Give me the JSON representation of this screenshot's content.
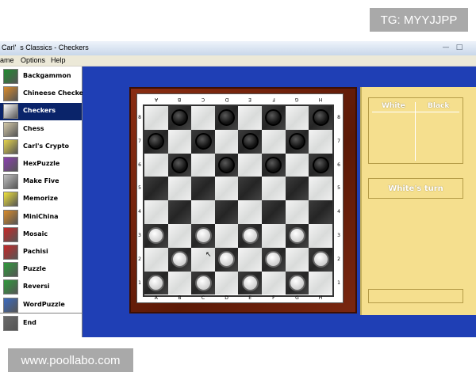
{
  "watermarks": {
    "top_right": "TG: MYYJJPP",
    "bottom_left": "www.poollabo.com"
  },
  "window": {
    "title": "Carl'  s Classics - Checkers"
  },
  "menu": [
    "ame",
    "Options",
    "Help"
  ],
  "sidebar": {
    "items": [
      {
        "label": "Backgammon",
        "icon": "backgammon-icon",
        "color": "#1e8b2e"
      },
      {
        "label": "Chineese Checkers",
        "icon": "chinese-checkers-icon",
        "color": "#d98a2a"
      },
      {
        "label": "Checkers",
        "icon": "checkers-icon",
        "color": "#ffffff",
        "selected": true
      },
      {
        "label": "Chess",
        "icon": "chess-icon",
        "color": "#d4c9a8"
      },
      {
        "label": "Carl's Crypto",
        "icon": "crypto-icon",
        "color": "#e4d34a"
      },
      {
        "label": "HexPuzzle",
        "icon": "hexpuzzle-icon",
        "color": "#8a3fb0"
      },
      {
        "label": "Make Five",
        "icon": "make-five-icon",
        "color": "#bfbfbf"
      },
      {
        "label": "Memorize",
        "icon": "memorize-icon",
        "color": "#f0e33a"
      },
      {
        "label": "MiniChina",
        "icon": "minichina-icon",
        "color": "#d98a2a"
      },
      {
        "label": "Mosaic",
        "icon": "mosaic-icon",
        "color": "#c62828"
      },
      {
        "label": "Pachisi",
        "icon": "pachisi-icon",
        "color": "#c62828"
      },
      {
        "label": "Puzzle",
        "icon": "puzzle-icon",
        "color": "#2e9a3a"
      },
      {
        "label": "Reversi",
        "icon": "reversi-icon",
        "color": "#2e9a3a"
      },
      {
        "label": "WordPuzzle",
        "icon": "wordpuzzle-icon",
        "color": "#3a6ac0"
      },
      {
        "label": "End",
        "icon": "exit-door-icon",
        "color": "#6a6a6a"
      }
    ]
  },
  "board": {
    "files_top": [
      "A",
      "B",
      "C",
      "D",
      "E",
      "F",
      "G",
      "H"
    ],
    "files_bottom": [
      "A",
      "B",
      "C",
      "D",
      "E",
      "F",
      "G",
      "H"
    ],
    "ranks": [
      "8",
      "7",
      "6",
      "5",
      "4",
      "3",
      "2",
      "1"
    ],
    "pieces": {
      "8": [
        "",
        "b",
        "",
        "b",
        "",
        "b",
        "",
        "b"
      ],
      "7": [
        "b",
        "",
        "b",
        "",
        "b",
        "",
        "b",
        ""
      ],
      "6": [
        "",
        "b",
        "",
        "b",
        "",
        "b",
        "",
        "b"
      ],
      "5": [
        "",
        "",
        "",
        "",
        "",
        "",
        "",
        ""
      ],
      "4": [
        "",
        "",
        "",
        "",
        "",
        "",
        "",
        ""
      ],
      "3": [
        "w",
        "",
        "w",
        "",
        "w",
        "",
        "w",
        ""
      ],
      "2": [
        "",
        "w",
        "",
        "w",
        "",
        "w",
        "",
        "w"
      ],
      "1": [
        "w",
        "",
        "w",
        "",
        "w",
        "",
        "w",
        ""
      ]
    }
  },
  "panel": {
    "col_white": "White",
    "col_black": "Black",
    "turn": "White's turn"
  },
  "colors": {
    "window_blue": "#1f3fb5",
    "selection": "#0a246a",
    "panel": "#f5df8e",
    "frame": "#6e220a"
  }
}
